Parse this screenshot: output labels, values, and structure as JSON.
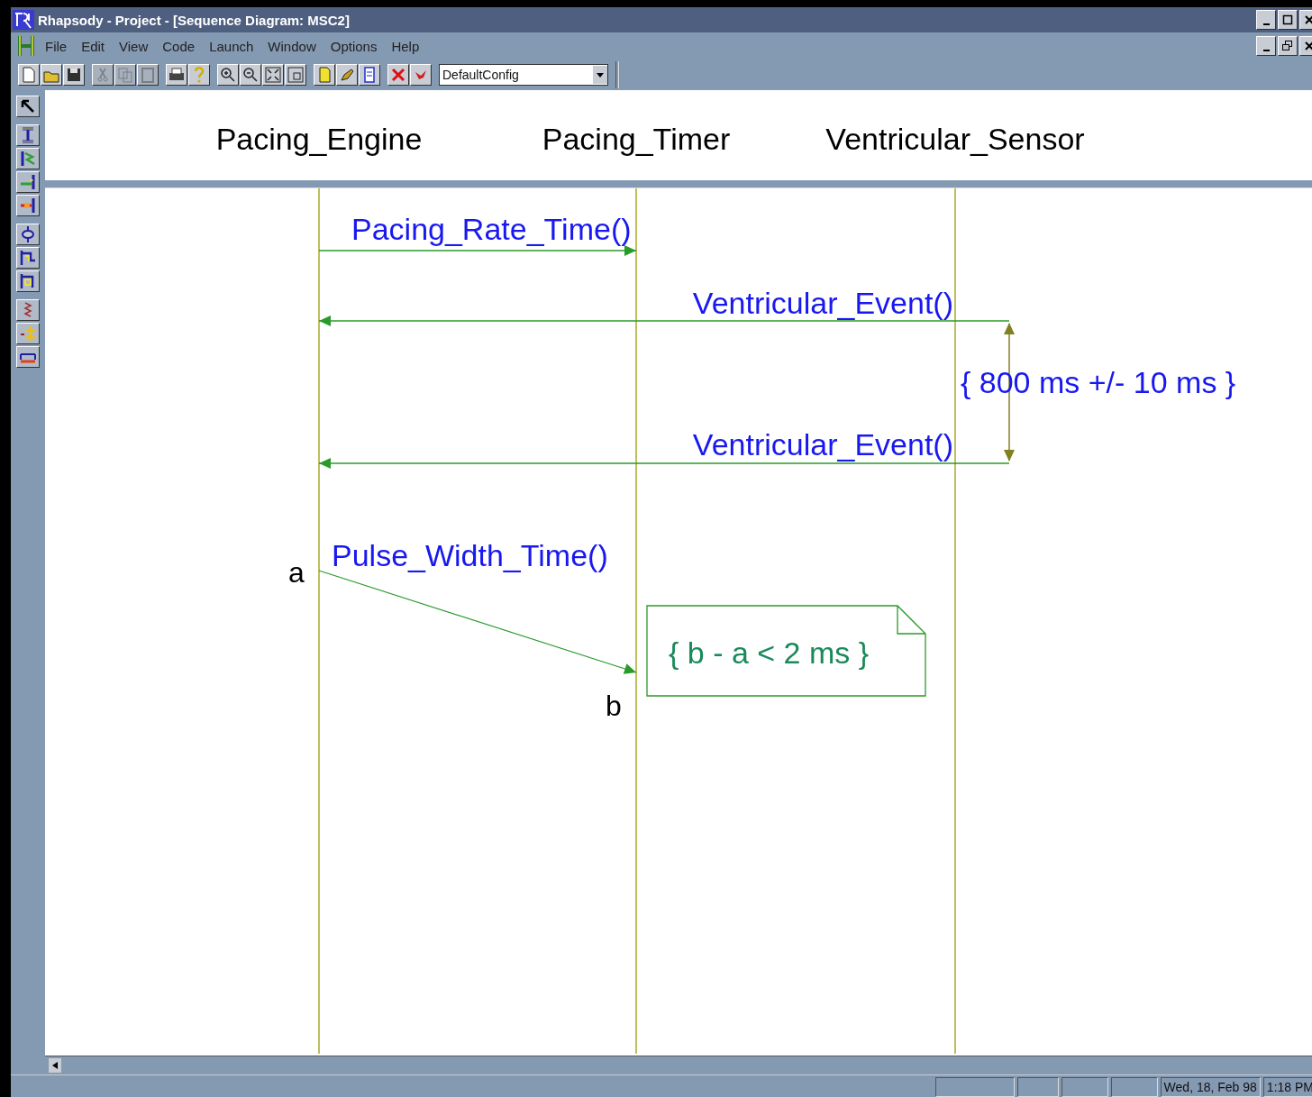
{
  "window": {
    "title": "Rhapsody - Project - [Sequence Diagram: MSC2]"
  },
  "menu": [
    "File",
    "Edit",
    "View",
    "Code",
    "Launch",
    "Window",
    "Options",
    "Help"
  ],
  "toolbar_buttons": [
    {
      "disabled": false
    },
    {
      "disabled": false
    },
    {
      "disabled": false
    },
    {
      "disabled": true
    },
    {
      "disabled": true
    },
    {
      "disabled": true
    },
    {
      "disabled": false
    },
    {
      "disabled": false
    },
    {
      "disabled": false
    },
    {
      "disabled": false
    },
    {
      "disabled": false
    },
    {
      "disabled": false
    },
    {
      "disabled": false
    },
    {
      "disabled": false
    },
    {
      "disabled": false
    },
    {
      "disabled": false
    },
    {
      "disabled": false
    }
  ],
  "config": {
    "value": "DefaultConfig"
  },
  "diagram": {
    "lifelines": [
      {
        "name": "Pacing_Engine"
      },
      {
        "name": "Pacing_Timer"
      },
      {
        "name": "Ventricular_Sensor"
      }
    ],
    "messages": [
      {
        "label": "Pacing_Rate_Time()",
        "reversed": false,
        "slanted": false
      },
      {
        "label": "Ventricular_Event()",
        "reversed": true,
        "slanted": false
      },
      {
        "label": "Ventricular_Event()",
        "reversed": true,
        "slanted": false
      },
      {
        "label": "Pulse_Width_Time()",
        "reversed": false,
        "slanted": true
      }
    ],
    "time_marks": [
      "a",
      "b"
    ],
    "timing_constraint": {
      "label": "{ 800 ms +/- 10 ms }"
    },
    "note": {
      "text": "{ b - a < 2 ms }"
    }
  },
  "status_bar": {
    "date": "Wed, 18, Feb 98",
    "time": "1:18 PM"
  }
}
